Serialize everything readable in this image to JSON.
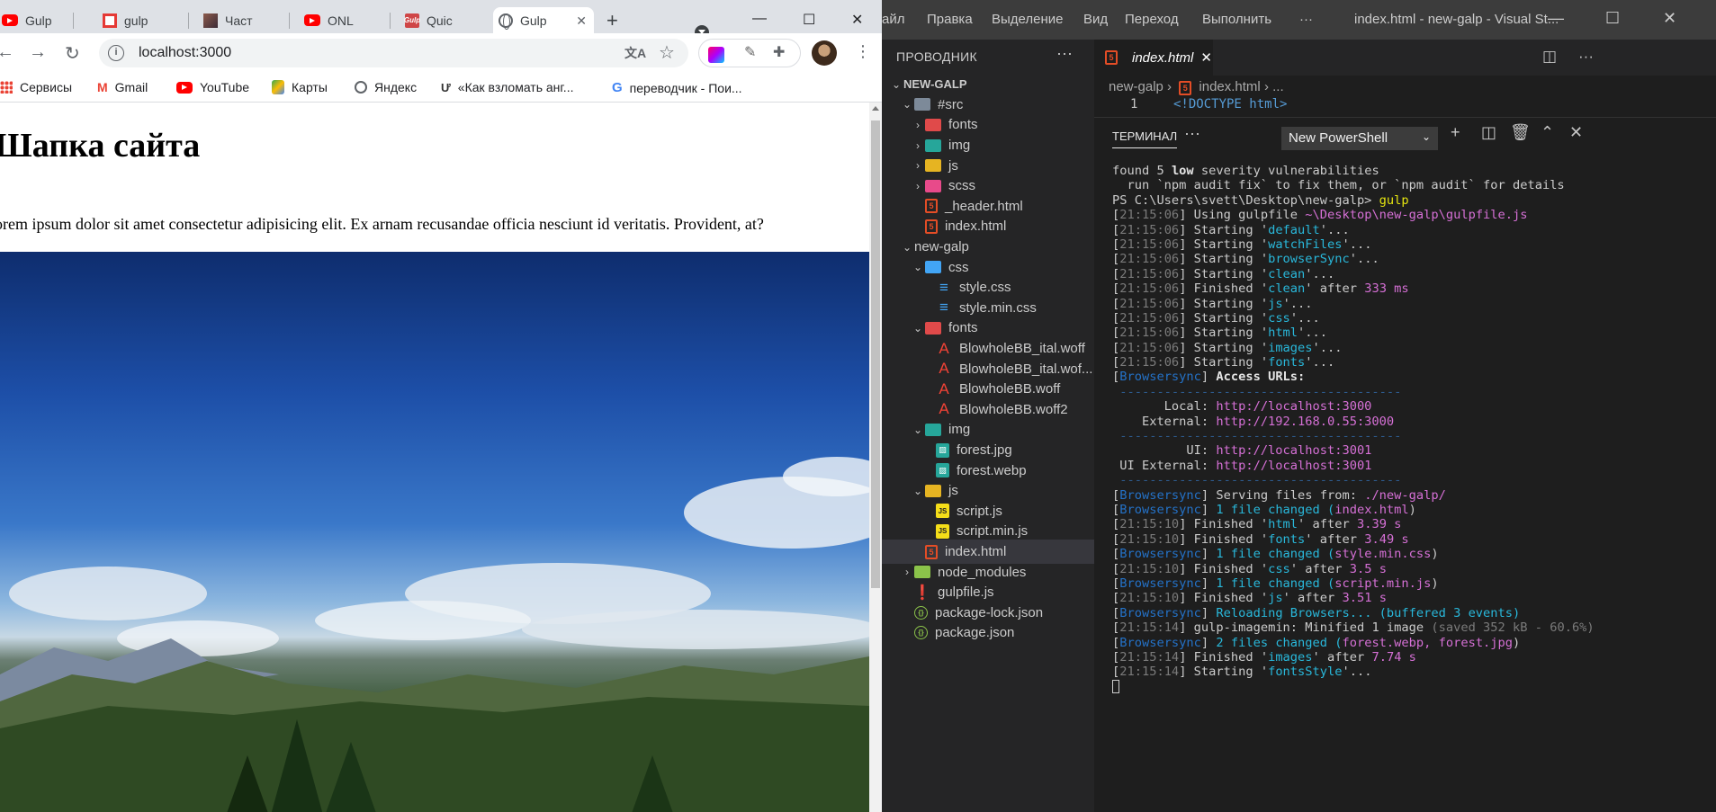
{
  "browser": {
    "tabs": [
      {
        "title": "Gulp",
        "icon": "youtube-icon"
      },
      {
        "title": "gulp",
        "icon": "red-frame-icon"
      },
      {
        "title": "Част",
        "icon": "photo-icon"
      },
      {
        "title": "ONL",
        "icon": "youtube-icon"
      },
      {
        "title": "Quic",
        "icon": "gulp-icon"
      },
      {
        "title": "Gulp",
        "icon": "globe-icon",
        "active": true
      }
    ],
    "url": "localhost:3000",
    "bookmarks": [
      {
        "label": "Сервисы",
        "icon": "apps-grid-icon"
      },
      {
        "label": "Gmail",
        "icon": "gmail-icon"
      },
      {
        "label": "YouTube",
        "icon": "youtube-icon"
      },
      {
        "label": "Карты",
        "icon": "maps-icon"
      },
      {
        "label": "Яндекс",
        "icon": "globe-icon"
      },
      {
        "label": "«Как взломать анг...",
        "icon": "u-logo-icon"
      },
      {
        "label": "переводчик - Пои...",
        "icon": "google-icon"
      }
    ],
    "page": {
      "heading": "Шапка сайта",
      "paragraph": "orem ipsum dolor sit amet consectetur adipisicing elit. Ex arnam recusandae officia nesciunt id veritatis. Provident, at?"
    }
  },
  "vscode": {
    "menu": [
      "айл",
      "Правка",
      "Выделение",
      "Вид",
      "Переход",
      "Выполнить",
      "···"
    ],
    "window_title": "index.html - new-galp - Visual St...",
    "explorer": {
      "title": "ПРОВОДНИК",
      "dots": "···",
      "tree": [
        {
          "label": "NEW-GALP",
          "depth": 0,
          "kind": "root",
          "chev": "v"
        },
        {
          "label": "#src",
          "depth": 1,
          "kind": "folder",
          "color": "gray",
          "chev": "v"
        },
        {
          "label": "fonts",
          "depth": 2,
          "kind": "folder",
          "color": "red",
          "chev": ">"
        },
        {
          "label": "img",
          "depth": 2,
          "kind": "folder",
          "color": "teal",
          "chev": ">"
        },
        {
          "label": "js",
          "depth": 2,
          "kind": "folder",
          "color": "yellow",
          "chev": ">"
        },
        {
          "label": "scss",
          "depth": 2,
          "kind": "folder",
          "color": "pink",
          "chev": ">"
        },
        {
          "label": "_header.html",
          "depth": 2,
          "kind": "html"
        },
        {
          "label": "index.html",
          "depth": 2,
          "kind": "html"
        },
        {
          "label": "new-galp",
          "depth": 1,
          "kind": "plain",
          "chev": "v"
        },
        {
          "label": "css",
          "depth": 2,
          "kind": "folder",
          "color": "blue",
          "chev": "v"
        },
        {
          "label": "style.css",
          "depth": 3,
          "kind": "css"
        },
        {
          "label": "style.min.css",
          "depth": 3,
          "kind": "css"
        },
        {
          "label": "fonts",
          "depth": 2,
          "kind": "folder",
          "color": "red",
          "chev": "v"
        },
        {
          "label": "BlowholeBB_ital.woff",
          "depth": 3,
          "kind": "font"
        },
        {
          "label": "BlowholeBB_ital.wof...",
          "depth": 3,
          "kind": "font"
        },
        {
          "label": "BlowholeBB.woff",
          "depth": 3,
          "kind": "font"
        },
        {
          "label": "BlowholeBB.woff2",
          "depth": 3,
          "kind": "font"
        },
        {
          "label": "img",
          "depth": 2,
          "kind": "folder",
          "color": "teal",
          "chev": "v"
        },
        {
          "label": "forest.jpg",
          "depth": 3,
          "kind": "image"
        },
        {
          "label": "forest.webp",
          "depth": 3,
          "kind": "image"
        },
        {
          "label": "js",
          "depth": 2,
          "kind": "folder",
          "color": "yellow",
          "chev": "v"
        },
        {
          "label": "script.js",
          "depth": 3,
          "kind": "js"
        },
        {
          "label": "script.min.js",
          "depth": 3,
          "kind": "js"
        },
        {
          "label": "index.html",
          "depth": 2,
          "kind": "html",
          "selected": true
        },
        {
          "label": "node_modules",
          "depth": 1,
          "kind": "folder",
          "color": "green",
          "chev": ">"
        },
        {
          "label": "gulpfile.js",
          "depth": 1,
          "kind": "gulp"
        },
        {
          "label": "package-lock.json",
          "depth": 1,
          "kind": "json"
        },
        {
          "label": "package.json",
          "depth": 1,
          "kind": "json"
        }
      ]
    },
    "editor_tab": "index.html",
    "breadcrumb": {
      "folder": "new-galp",
      "file": "index.html",
      "tail": "..."
    },
    "code_line": {
      "number": "1",
      "text": "<!DOCTYPE html>"
    },
    "panel": {
      "title": "ТЕРМИНАЛ",
      "dots": "···",
      "shell": "New PowerShell"
    },
    "terminal_lines": [
      [
        [
          "found 5 ",
          ""
        ],
        [
          "low",
          "bold"
        ],
        [
          " severity vulnerabilities",
          ""
        ]
      ],
      [
        [
          "  run `npm audit fix` to fix them, or `npm audit` for details",
          ""
        ]
      ],
      [
        [
          "PS C:\\Users\\svett\\Desktop\\new-galp> ",
          ""
        ],
        [
          "gulp",
          "cmd"
        ]
      ],
      [
        [
          "[",
          ""
        ],
        [
          "21:15:06",
          "ts"
        ],
        [
          "] Using gulpfile ",
          ""
        ],
        [
          "~\\Desktop\\new-galp\\gulpfile.js",
          "path"
        ]
      ],
      [
        [
          "[",
          ""
        ],
        [
          "21:15:06",
          "ts"
        ],
        [
          "] Starting '",
          ""
        ],
        [
          "default",
          "str"
        ],
        [
          "'...",
          ""
        ]
      ],
      [
        [
          "[",
          ""
        ],
        [
          "21:15:06",
          "ts"
        ],
        [
          "] Starting '",
          ""
        ],
        [
          "watchFiles",
          "str"
        ],
        [
          "'...",
          ""
        ]
      ],
      [
        [
          "[",
          ""
        ],
        [
          "21:15:06",
          "ts"
        ],
        [
          "] Starting '",
          ""
        ],
        [
          "browserSync",
          "str"
        ],
        [
          "'...",
          ""
        ]
      ],
      [
        [
          "[",
          ""
        ],
        [
          "21:15:06",
          "ts"
        ],
        [
          "] Starting '",
          ""
        ],
        [
          "clean",
          "str"
        ],
        [
          "'...",
          ""
        ]
      ],
      [
        [
          "[",
          ""
        ],
        [
          "21:15:06",
          "ts"
        ],
        [
          "] Finished '",
          ""
        ],
        [
          "clean",
          "str"
        ],
        [
          "' after ",
          ""
        ],
        [
          "333 ms",
          "num"
        ]
      ],
      [
        [
          "[",
          ""
        ],
        [
          "21:15:06",
          "ts"
        ],
        [
          "] Starting '",
          ""
        ],
        [
          "js",
          "str"
        ],
        [
          "'...",
          ""
        ]
      ],
      [
        [
          "[",
          ""
        ],
        [
          "21:15:06",
          "ts"
        ],
        [
          "] Starting '",
          ""
        ],
        [
          "css",
          "str"
        ],
        [
          "'...",
          ""
        ]
      ],
      [
        [
          "[",
          ""
        ],
        [
          "21:15:06",
          "ts"
        ],
        [
          "] Starting '",
          ""
        ],
        [
          "html",
          "str"
        ],
        [
          "'...",
          ""
        ]
      ],
      [
        [
          "[",
          ""
        ],
        [
          "21:15:06",
          "ts"
        ],
        [
          "] Starting '",
          ""
        ],
        [
          "images",
          "str"
        ],
        [
          "'...",
          ""
        ]
      ],
      [
        [
          "[",
          ""
        ],
        [
          "21:15:06",
          "ts"
        ],
        [
          "] Starting '",
          ""
        ],
        [
          "fonts",
          "str"
        ],
        [
          "'...",
          ""
        ]
      ],
      [
        [
          "[",
          ""
        ],
        [
          "Browsersync",
          "bs"
        ],
        [
          "] ",
          ""
        ],
        [
          "Access URLs:",
          "bold"
        ]
      ],
      [
        [
          " --------------------------------------",
          "sep"
        ]
      ],
      [
        [
          "       Local: ",
          ""
        ],
        [
          "http://localhost:3000",
          "path"
        ]
      ],
      [
        [
          "    External: ",
          ""
        ],
        [
          "http://192.168.0.55:3000",
          "path"
        ]
      ],
      [
        [
          " --------------------------------------",
          "sep"
        ]
      ],
      [
        [
          "          UI: ",
          ""
        ],
        [
          "http://localhost:3001",
          "path"
        ]
      ],
      [
        [
          " UI External: ",
          ""
        ],
        [
          "http://localhost:3001",
          "path"
        ]
      ],
      [
        [
          " --------------------------------------",
          "sep"
        ]
      ],
      [
        [
          "[",
          ""
        ],
        [
          "Browsersync",
          "bs"
        ],
        [
          "] Serving files from: ",
          ""
        ],
        [
          "./new-galp/",
          "path"
        ]
      ],
      [
        [
          "[",
          ""
        ],
        [
          "Browsersync",
          "bs"
        ],
        [
          "] ",
          ""
        ],
        [
          "1 file changed (",
          "str"
        ],
        [
          "index.html",
          "path"
        ],
        [
          ")",
          ""
        ]
      ],
      [
        [
          "[",
          ""
        ],
        [
          "21:15:10",
          "ts"
        ],
        [
          "] Finished '",
          ""
        ],
        [
          "html",
          "str"
        ],
        [
          "' after ",
          ""
        ],
        [
          "3.39 s",
          "num"
        ]
      ],
      [
        [
          "[",
          ""
        ],
        [
          "21:15:10",
          "ts"
        ],
        [
          "] Finished '",
          ""
        ],
        [
          "fonts",
          "str"
        ],
        [
          "' after ",
          ""
        ],
        [
          "3.49 s",
          "num"
        ]
      ],
      [
        [
          "[",
          ""
        ],
        [
          "Browsersync",
          "bs"
        ],
        [
          "] ",
          ""
        ],
        [
          "1 file changed (",
          "str"
        ],
        [
          "style.min.css",
          "path"
        ],
        [
          ")",
          ""
        ]
      ],
      [
        [
          "[",
          ""
        ],
        [
          "21:15:10",
          "ts"
        ],
        [
          "] Finished '",
          ""
        ],
        [
          "css",
          "str"
        ],
        [
          "' after ",
          ""
        ],
        [
          "3.5 s",
          "num"
        ]
      ],
      [
        [
          "[",
          ""
        ],
        [
          "Browsersync",
          "bs"
        ],
        [
          "] ",
          ""
        ],
        [
          "1 file changed (",
          "str"
        ],
        [
          "script.min.js",
          "path"
        ],
        [
          ")",
          ""
        ]
      ],
      [
        [
          "[",
          ""
        ],
        [
          "21:15:10",
          "ts"
        ],
        [
          "] Finished '",
          ""
        ],
        [
          "js",
          "str"
        ],
        [
          "' after ",
          ""
        ],
        [
          "3.51 s",
          "num"
        ]
      ],
      [
        [
          "[",
          ""
        ],
        [
          "Browsersync",
          "bs"
        ],
        [
          "] ",
          ""
        ],
        [
          "Reloading Browsers... (buffered 3 events)",
          "str"
        ]
      ],
      [
        [
          "[",
          ""
        ],
        [
          "21:15:14",
          "ts"
        ],
        [
          "] gulp-imagemin: Minified 1 image ",
          ""
        ],
        [
          "(saved 352 kB - 60.6%)",
          "gray"
        ]
      ],
      [
        [
          "[",
          ""
        ],
        [
          "Browsersync",
          "bs"
        ],
        [
          "] ",
          ""
        ],
        [
          "2 files changed (",
          "str"
        ],
        [
          "forest.webp, forest.jpg",
          "path"
        ],
        [
          ")",
          ""
        ]
      ],
      [
        [
          "[",
          ""
        ],
        [
          "21:15:14",
          "ts"
        ],
        [
          "] Finished '",
          ""
        ],
        [
          "images",
          "str"
        ],
        [
          "' after ",
          ""
        ],
        [
          "7.74 s",
          "num"
        ]
      ],
      [
        [
          "[",
          ""
        ],
        [
          "21:15:14",
          "ts"
        ],
        [
          "] Starting '",
          ""
        ],
        [
          "fontsStyle",
          "str"
        ],
        [
          "'...",
          ""
        ]
      ]
    ]
  },
  "colors": {
    "vscode_bg": "#1e1e1e",
    "sidebar_bg": "#252526",
    "titlebar_bg": "#3c3c3c",
    "chrome_tabstrip": "#dee1e6",
    "terminal_string": "#29b8db",
    "terminal_magenta": "#d670d6",
    "terminal_browsersync": "#2472c8"
  }
}
